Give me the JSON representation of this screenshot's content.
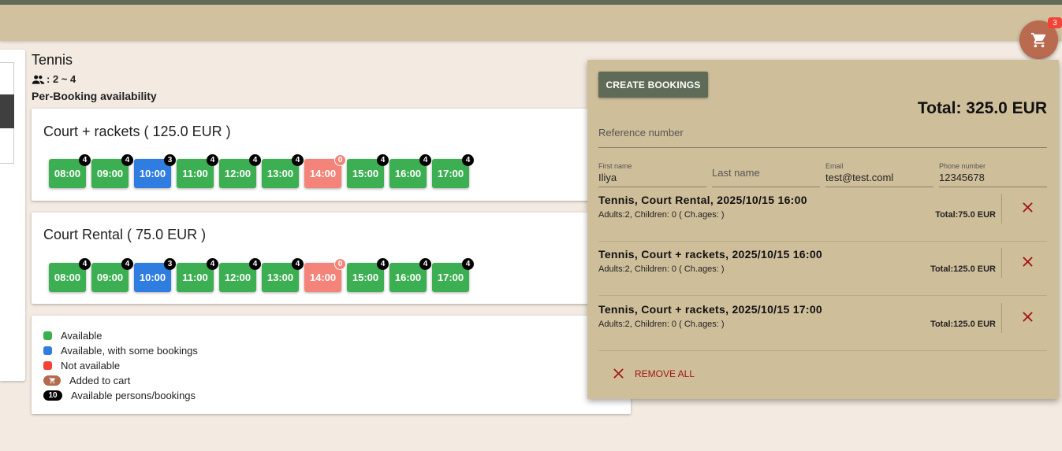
{
  "activity": {
    "title": "Tennis",
    "persons": ": 2 ~ 4",
    "availability_mode": "Per-Booking availability"
  },
  "services": [
    {
      "title": "Court + rackets ( 125.0 EUR )",
      "slots": [
        {
          "time": "08:00",
          "count": "4",
          "status": "green"
        },
        {
          "time": "09:00",
          "count": "4",
          "status": "green"
        },
        {
          "time": "10:00",
          "count": "3",
          "status": "blue"
        },
        {
          "time": "11:00",
          "count": "4",
          "status": "green"
        },
        {
          "time": "12:00",
          "count": "4",
          "status": "green"
        },
        {
          "time": "13:00",
          "count": "4",
          "status": "green"
        },
        {
          "time": "14:00",
          "count": "0",
          "status": "red"
        },
        {
          "time": "15:00",
          "count": "4",
          "status": "green"
        },
        {
          "time": "16:00",
          "count": "4",
          "status": "green"
        },
        {
          "time": "17:00",
          "count": "4",
          "status": "green"
        }
      ]
    },
    {
      "title": "Court Rental ( 75.0 EUR )",
      "slots": [
        {
          "time": "08:00",
          "count": "4",
          "status": "green"
        },
        {
          "time": "09:00",
          "count": "4",
          "status": "green"
        },
        {
          "time": "10:00",
          "count": "3",
          "status": "blue"
        },
        {
          "time": "11:00",
          "count": "4",
          "status": "green"
        },
        {
          "time": "12:00",
          "count": "4",
          "status": "green"
        },
        {
          "time": "13:00",
          "count": "4",
          "status": "green"
        },
        {
          "time": "14:00",
          "count": "0",
          "status": "red"
        },
        {
          "time": "15:00",
          "count": "4",
          "status": "green"
        },
        {
          "time": "16:00",
          "count": "4",
          "status": "green"
        },
        {
          "time": "17:00",
          "count": "4",
          "status": "green"
        }
      ]
    }
  ],
  "legend": {
    "available": "Available",
    "available_some": "Available, with some bookings",
    "not_available": "Not available",
    "added_to_cart": "Added to cart",
    "persons_chip": "10",
    "persons_label": "Available persons/bookings"
  },
  "cart": {
    "badge": "3",
    "create_label": "CREATE BOOKINGS",
    "total": "Total: 325.0 EUR",
    "reference_placeholder": "Reference number",
    "first_name_label": "First name",
    "first_name_value": "Iliya",
    "last_name_placeholder": "Last name",
    "email_label": "Email",
    "email_value": "test@test.coml",
    "phone_label": "Phone number",
    "phone_value": "12345678",
    "items": [
      {
        "title": "Tennis, Court Rental, 2025/10/15 16:00",
        "sub": "Adults:2, Children: 0 ( Ch.ages: )",
        "total": "Total:75.0 EUR"
      },
      {
        "title": "Tennis, Court + rackets, 2025/10/15 16:00",
        "sub": "Adults:2, Children: 0 ( Ch.ages: )",
        "total": "Total:125.0 EUR"
      },
      {
        "title": "Tennis, Court + rackets, 2025/10/15 17:00",
        "sub": "Adults:2, Children: 0 ( Ch.ages: )",
        "total": "Total:125.0 EUR"
      }
    ],
    "remove_all_label": "REMOVE ALL"
  },
  "colors": {
    "green": "#3caf52",
    "blue": "#2f7de0",
    "red": "#f4847a",
    "header": "#d1c19e",
    "panel": "#cfbe9a",
    "accent": "#5f6b56",
    "cart_fab": "#b96a4f"
  }
}
